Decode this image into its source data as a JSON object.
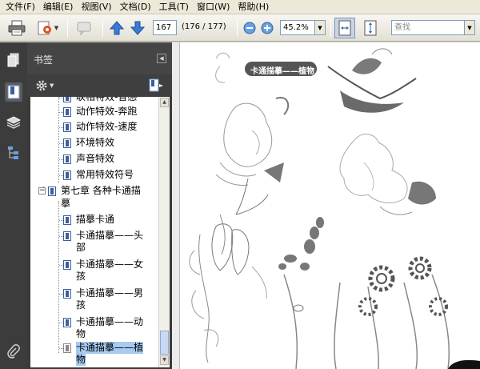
{
  "menu": [
    "文件(F)",
    "编辑(E)",
    "视图(V)",
    "文档(D)",
    "工具(T)",
    "窗口(W)",
    "帮助(H)"
  ],
  "toolbar": {
    "page_current": "167",
    "page_info": "(176 / 177)",
    "zoom_value": "45.2%",
    "search_placeholder": "查找"
  },
  "panel": {
    "title": "书签"
  },
  "bookmarks": [
    {
      "label": "联相特效-音感",
      "level": 2
    },
    {
      "label": "动作特效-奔跑",
      "level": 2
    },
    {
      "label": "动作特效-速度",
      "level": 2
    },
    {
      "label": "环境特效",
      "level": 2
    },
    {
      "label": "声音特效",
      "level": 2
    },
    {
      "label": "常用特效符号",
      "level": 2
    },
    {
      "label_line1": "第七章  各种卡通描",
      "label_line2": "摹",
      "level": 1
    },
    {
      "label": "描摹卡通",
      "level": 2
    },
    {
      "label_line1": "卡通描摹——头",
      "label_line2": "部",
      "level": 2
    },
    {
      "label_line1": "卡通描摹——女",
      "label_line2": "孩",
      "level": 2
    },
    {
      "label_line1": "卡通描摹——男",
      "label_line2": "孩",
      "level": 2
    },
    {
      "label_line1": "卡通描摹——动",
      "label_line2": "物",
      "level": 2
    },
    {
      "label_line1": "卡通描摹——植",
      "label_line2": "物",
      "level": 2,
      "selected": true
    }
  ],
  "document": {
    "banner_text": "卡通描摹——植物"
  },
  "colors": {
    "menubar_bg": "#ece9d8",
    "panel_dark": "#3a3a3a",
    "selection": "#a6caf0",
    "banner_bg": "#555555"
  }
}
